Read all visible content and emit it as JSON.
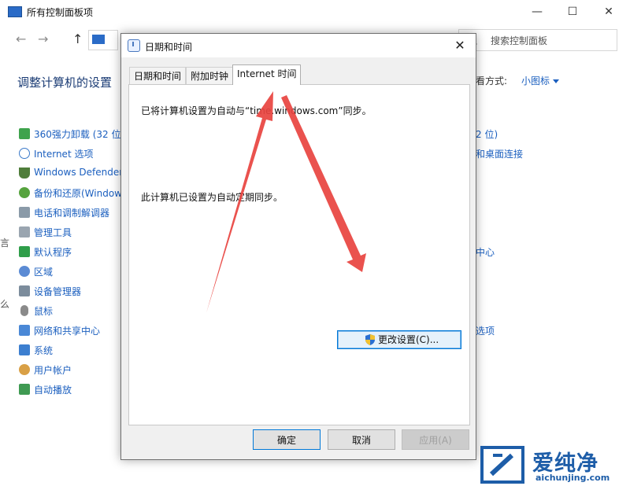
{
  "window": {
    "title": "所有控制面板项",
    "minimize": "—",
    "maximize": "☐",
    "close": "✕"
  },
  "address": {
    "back": "←",
    "forward": "→",
    "up": "↑",
    "search_placeholder": "搜索控制面板"
  },
  "page": {
    "heading": "调整计算机的设置",
    "view_label": "查看方式:",
    "view_value": "小图标"
  },
  "left_items": [
    "360强力卸载 (32 位)",
    "Internet 选项",
    "Windows Defender",
    "备份和还原(Windows",
    "电话和调制解调器",
    "管理工具",
    "默认程序",
    "区域",
    "设备管理器",
    "鼠标",
    "网络和共享中心",
    "系统",
    "用户帐户",
    "自动播放"
  ],
  "right_items": [
    "2 位)",
    "和桌面连接",
    "中心",
    "选项"
  ],
  "left_cut": [
    "言",
    "么"
  ],
  "dialog": {
    "title": "日期和时间",
    "close": "✕",
    "tabs": [
      "日期和时间",
      "附加时钟",
      "Internet 时间"
    ],
    "active_tab": 2,
    "sync_text": "已将计算机设置为自动与“time.windows.com”同步。",
    "auto_text": "此计算机已设置为自动定期同步。",
    "change_button": "更改设置(C)...",
    "ok_button": "确定",
    "cancel_button": "取消",
    "apply_button": "应用(A)"
  },
  "watermark": {
    "cn": "爱纯净",
    "en": "aichunjing.com"
  },
  "colors": {
    "link": "#1b5fbf",
    "accent": "#0078d7",
    "arrow": "#e8433f"
  }
}
